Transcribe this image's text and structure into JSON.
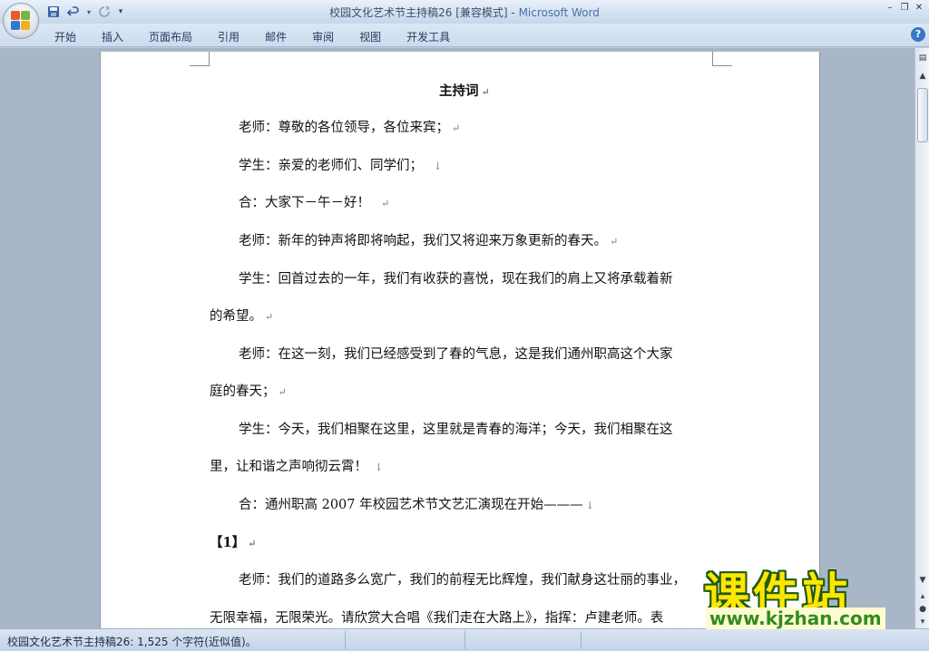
{
  "window": {
    "title_doc": "校园文化艺术节主持稿26 [兼容模式] - ",
    "title_app": "Microsoft Word"
  },
  "quick_access": {
    "save_icon": "save-icon",
    "undo_icon": "undo-icon",
    "redo_icon": "redo-icon",
    "customize_icon": "customize-icon"
  },
  "ribbon": {
    "tabs": [
      "开始",
      "插入",
      "页面布局",
      "引用",
      "邮件",
      "审阅",
      "视图",
      "开发工具"
    ]
  },
  "document": {
    "heading": "主持词",
    "paragraph_marks": {
      "return": "↵",
      "line_break": "↓"
    },
    "lines": [
      "老师：尊敬的各位领导，各位来宾；",
      "学生：亲爱的老师们、同学们；",
      "合：大家下－午－好！",
      "老师：新年的钟声将即将响起，我们又将迎来万象更新的春天。",
      "学生：回首过去的一年，我们有收获的喜悦，现在我们的肩上又将承载着新",
      "的希望。",
      "老师：在这一刻，我们已经感受到了春的气息，这是我们通州职高这个大家",
      "庭的春天；",
      "学生：今天，我们相聚在这里，这里就是青春的海洋；今天，我们相聚在这",
      "里，让和谐之声响彻云霄！",
      "合：通州职高 2007 年校园艺术节文艺汇演现在开始———",
      "【1】",
      "老师：我们的道路多么宽广，我们的前程无比辉煌，我们献身这壮丽的事业，",
      "无限幸福，无限荣光。请欣赏大合唱《我们走在大路上》，指挥：卢建老师。表"
    ]
  },
  "status_bar": {
    "text": "校园文化艺术节主持稿26: 1,525 个字符(近似值)。"
  },
  "watermark": {
    "title": "课件站",
    "url": "www.kjzhan.com"
  },
  "colors": {
    "workspace": "#a9b6c7",
    "ribbon": "#cddbee",
    "watermark_yellow": "#ffe600",
    "watermark_green": "#2f8d1d"
  }
}
